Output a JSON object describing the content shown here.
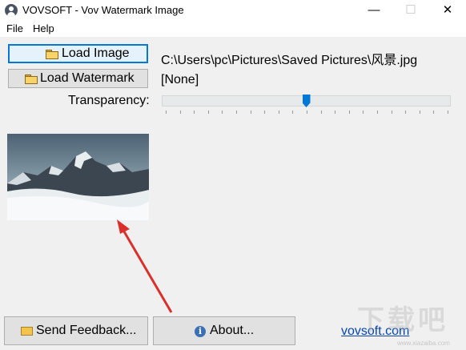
{
  "window": {
    "title": "VOVSOFT - Vov Watermark Image",
    "minimize": "—",
    "maximize": "☐",
    "close": "✕"
  },
  "menu": {
    "file": "File",
    "help": "Help"
  },
  "buttons": {
    "load_image": "Load Image",
    "load_watermark": "Load Watermark",
    "send_feedback": "Send Feedback...",
    "about": "About..."
  },
  "fields": {
    "image_path": "C:\\Users\\pc\\Pictures\\Saved Pictures\\风景.jpg",
    "watermark_path": "[None]",
    "transparency_label": "Transparency:",
    "transparency_value": 0.5
  },
  "footer": {
    "website_link": "vovsoft.com"
  },
  "overlay_watermark": {
    "text": "下载吧",
    "url": "www.xiazaiba.com"
  }
}
